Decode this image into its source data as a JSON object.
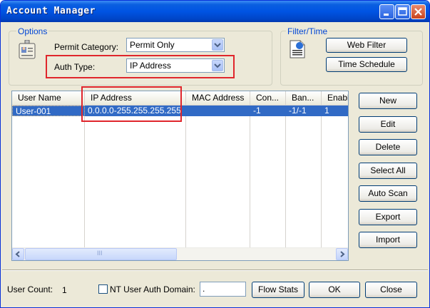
{
  "window": {
    "title": "Account Manager"
  },
  "options": {
    "legend": "Options",
    "permit_category_label": "Permit Category:",
    "permit_category_value": "Permit Only",
    "auth_type_label": "Auth Type:",
    "auth_type_value": "IP Address"
  },
  "filter": {
    "legend": "Filter/Time",
    "web_filter_label": "Web Filter",
    "time_schedule_label": "Time Schedule"
  },
  "table": {
    "columns": [
      "User Name",
      "IP Address",
      "MAC Address",
      "Con...",
      "Ban...",
      "Enabl"
    ],
    "rows": [
      {
        "user_name": "User-001",
        "ip_address": "0.0.0.0-255.255.255.255",
        "mac_address": "",
        "con": "-1",
        "ban": "-1/-1",
        "enable": "1"
      }
    ],
    "scroll_thumb_grip": "III"
  },
  "actions": {
    "new": "New",
    "edit": "Edit",
    "delete": "Delete",
    "select_all": "Select All",
    "auto_scan": "Auto Scan",
    "export": "Export",
    "import": "Import"
  },
  "footer": {
    "user_count_label": "User Count:",
    "user_count_value": "1",
    "nt_auth_label": "NT User Auth Domain:",
    "nt_auth_checked": false,
    "domain_value": ".",
    "flow_stats": "Flow Stats",
    "ok": "OK",
    "close": "Close"
  },
  "colors": {
    "title_bar": "#0054e3",
    "selection": "#316ac5",
    "highlight_box": "#e0262c",
    "legend_text": "#0046d5"
  }
}
